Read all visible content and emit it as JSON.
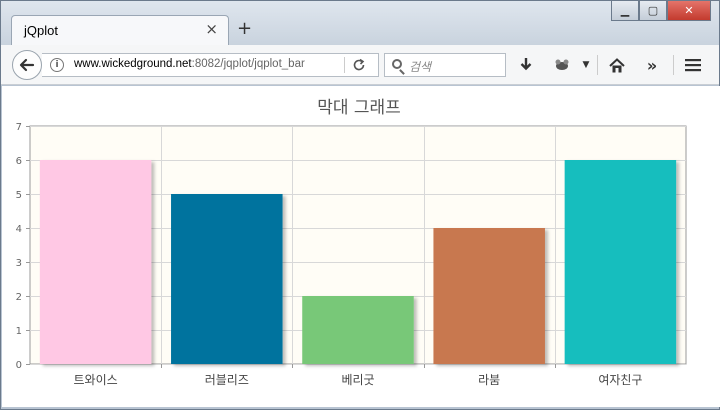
{
  "browser": {
    "tab_title": "jQplot",
    "tab_close": "×",
    "new_tab": "+",
    "url_domain": "www.wickedground.net",
    "url_rest": ":8082/jqplot/jqplot_bar",
    "search_placeholder": "검색",
    "icons": [
      "back-arrow-icon",
      "info-icon",
      "reload-icon",
      "search-icon",
      "download-icon",
      "extension-icon",
      "home-icon",
      "overflow-icon",
      "menu-icon"
    ]
  },
  "chart_data": {
    "type": "bar",
    "title": "막대 그래프",
    "categories": [
      "트와이스",
      "러블리즈",
      "베리굿",
      "라붐",
      "여자친구"
    ],
    "values": [
      6,
      5,
      2,
      4,
      6
    ],
    "colors": [
      "#ffc8e4",
      "#00739e",
      "#78c878",
      "#c8784f",
      "#18bebe"
    ],
    "ylim": [
      0,
      7
    ],
    "yticks": [
      "0",
      "1",
      "2",
      "3",
      "4",
      "5",
      "6",
      "7"
    ],
    "xlabel": "",
    "ylabel": "",
    "grid": true,
    "background": "#fffdf6"
  }
}
